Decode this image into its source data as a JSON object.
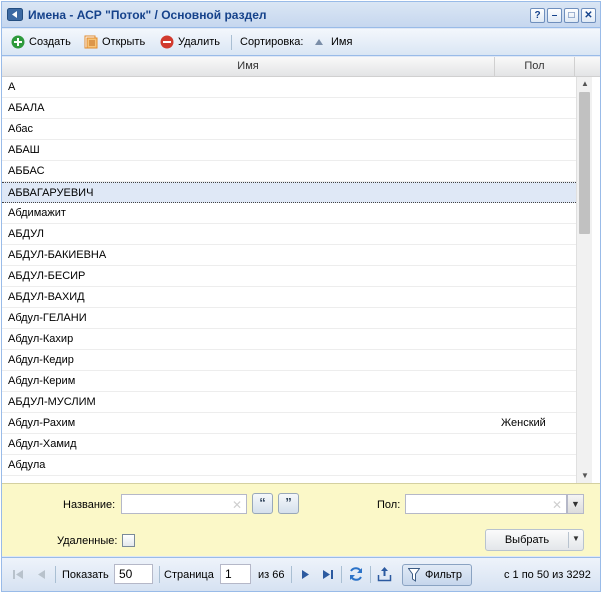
{
  "window": {
    "title": "Имена - АСР \"Поток\" / Основной раздел",
    "tools": [
      "?",
      "–",
      "□",
      "✕"
    ]
  },
  "toolbar": {
    "create_label": "Создать",
    "open_label": "Открыть",
    "delete_label": "Удалить",
    "sort_label": "Сортировка:",
    "sort_field": "Имя"
  },
  "grid": {
    "columns": [
      "Имя",
      "Пол"
    ],
    "rows": [
      {
        "name": "А",
        "sex": ""
      },
      {
        "name": "АБАЛА",
        "sex": ""
      },
      {
        "name": "Абас",
        "sex": ""
      },
      {
        "name": "АБАШ",
        "sex": ""
      },
      {
        "name": "АББАС",
        "sex": ""
      },
      {
        "name": "АБВАГАРУЕВИЧ",
        "sex": ""
      },
      {
        "name": "Абдимажит",
        "sex": ""
      },
      {
        "name": "АБДУЛ",
        "sex": ""
      },
      {
        "name": "АБДУЛ-БАКИЕВНА",
        "sex": ""
      },
      {
        "name": "АБДУЛ-БЕСИР",
        "sex": ""
      },
      {
        "name": "АБДУЛ-ВАХИД",
        "sex": ""
      },
      {
        "name": "Абдул-ГЕЛАНИ",
        "sex": ""
      },
      {
        "name": "Абдул-Кахир",
        "sex": ""
      },
      {
        "name": "Абдул-Кедир",
        "sex": ""
      },
      {
        "name": "Абдул-Керим",
        "sex": ""
      },
      {
        "name": "АБДУЛ-МУСЛИМ",
        "sex": ""
      },
      {
        "name": "Абдул-Рахим",
        "sex": "Женский"
      },
      {
        "name": "Абдул-Хамид",
        "sex": ""
      },
      {
        "name": "Абдула",
        "sex": ""
      }
    ],
    "selected_index": 5
  },
  "filter": {
    "name_label": "Название:",
    "name_value": "",
    "sex_label": "Пол:",
    "sex_value": "",
    "deleted_label": "Удаленные:",
    "select_button": "Выбрать"
  },
  "paging": {
    "show_label": "Показать",
    "page_size": "50",
    "page_label": "Страница",
    "page_value": "1",
    "of_label": "из 66",
    "filter_label": "Фильтр",
    "summary": "с 1 по 50 из 3292"
  }
}
